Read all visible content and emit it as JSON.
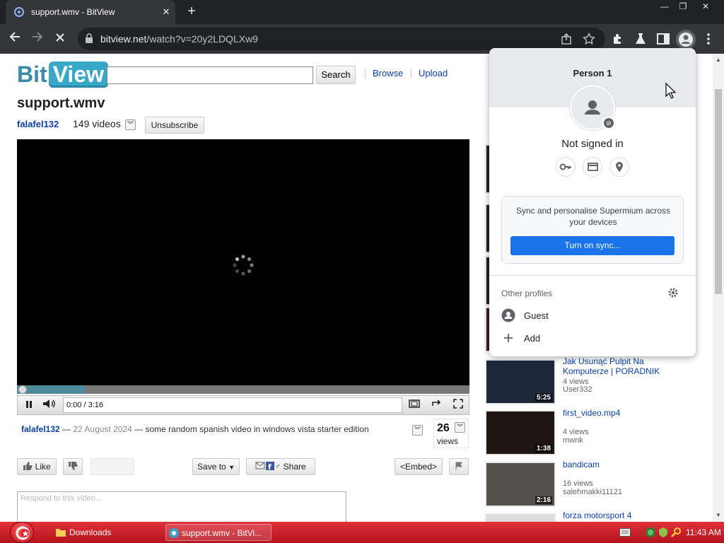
{
  "browser": {
    "tab_title": "support.wmv - BitView",
    "tab_close": "✕",
    "new_tab": "+",
    "url_host": "bitview.net",
    "url_path": "/watch?v=20y2LDQLXw9",
    "window_buttons": [
      "—",
      "❐",
      "✕"
    ]
  },
  "site": {
    "logo_bit": "Bit",
    "logo_view": "View",
    "search_button": "Search",
    "nav": [
      "Browse",
      "Upload"
    ]
  },
  "video": {
    "title": "support.wmv",
    "uploader": "falafel132",
    "video_count": "149 videos",
    "unsubscribe": "Unsubscribe",
    "time": "0:00 / 3:16",
    "progress_buffered": 0.15,
    "description_author": "falafel132",
    "description_sep1": " — ",
    "description_date": "22 August 2024",
    "description_sep2": " — ",
    "description_text": "some random spanish video in windows vista starter edition",
    "views_count": "26",
    "views_label": "views",
    "actions": {
      "like": "Like",
      "save_to": "Save to",
      "share": "Share",
      "embed": "<Embed>"
    },
    "respond_placeholder": "Respond to this video..."
  },
  "related": [
    {
      "title": "Jak Usunąć Pulpit Na Komputerze | PORADNIK",
      "views": "4 views",
      "user": "User332",
      "duration": "5:25"
    },
    {
      "title": "first_video.mp4",
      "views": "4 views",
      "user": "mwnk",
      "duration": "1:38"
    },
    {
      "title": "bandicam",
      "views": "16 views",
      "user": "salehmakki11121",
      "duration": "2:16"
    },
    {
      "title": "forza motorsport 4",
      "views": "",
      "user": "",
      "duration": ""
    }
  ],
  "profile_popup": {
    "name": "Person 1",
    "status": "Not signed in",
    "sync_text": "Sync and personalise Supermium across your devices",
    "sync_button": "Turn on sync...",
    "other_profiles": "Other profiles",
    "profiles": [
      "Guest",
      "Add"
    ]
  },
  "taskbar": {
    "items": [
      "Downloads",
      "support.wmv - BitVi..."
    ],
    "clock": "11:43 AM"
  },
  "colors": {
    "link": "#0b3ea6",
    "sync_button": "#1a73e8",
    "taskbar": "#c8202a"
  }
}
